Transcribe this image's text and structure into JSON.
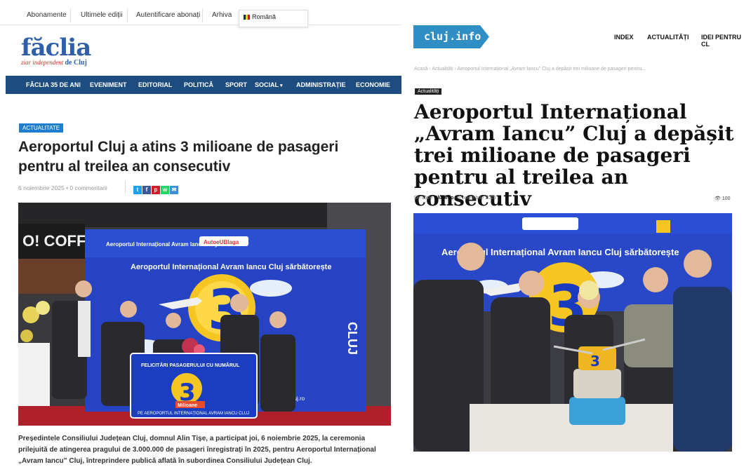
{
  "left": {
    "topbar": {
      "links": [
        "Abonamente",
        "Ultimele ediții",
        "Autentificare abonați",
        "Arhiva"
      ],
      "language": "Română"
    },
    "logo": {
      "name": "făclia",
      "tagline": "ziar independent",
      "tagline_bold": "de Cluj"
    },
    "nav": [
      "FĂCLIA 35 DE ANI",
      "EVENIMENT",
      "EDITORIAL",
      "POLITICĂ",
      "SPORT",
      "SOCIAL",
      "ADMINISTRAȚIE",
      "ECONOMIE"
    ],
    "article": {
      "category": "ACTUALITATE",
      "title": "Aeroportul Cluj a atins 3 milioane de pasageri pentru al treilea an consecutiv",
      "date": "6 noiembrie 2025",
      "comments": "0 commentarii",
      "photo": {
        "coffee_sign": "O! COFFEE",
        "banner_top": "Aeroportul Internațional Avram Iancu Cluj",
        "banner_headline": "Aeroportul Internațional Avram Iancu Cluj sărbătorește",
        "big_number": "3",
        "word": "Milioane",
        "board_title": "FELICITĂRI PASAGERULUI CU NUMĂRUL",
        "board_footer": "PE AEROPORTUL INTERNAȚIONAL AVRAM IANCU CLUJ",
        "url": "www.airportcluj.ro",
        "vertical": "CLUJ",
        "sponsor": "AutoeUBlaga"
      },
      "body": "Președintele Consiliului Județean Cluj, domnul Alin Tișe, a participat joi, 6 noiembrie 2025, la ceremonia prilejuită de atingerea pragului de 3.000.000 de pasageri înregistrați în 2025, pentru Aeroportul Internațional „Avram Iancu” Cluj, întreprindere publică aflată în subordinea Consiliului Județean Cluj."
    }
  },
  "right": {
    "logo": "cluj.info",
    "nav": [
      "INDEX",
      "ACTUALITĂȚI",
      "IDEI PENTRU CL"
    ],
    "breadcrumb": [
      "Acasă",
      "Actualități",
      "Aeroportul Internațional „Avram Iancu” Cluj a depășit trei milioane de pasageri pentru..."
    ],
    "category": "Actualități",
    "title": "Aeroportul Internațional „Avram Iancu” Cluj a depășit trei milioane de pasageri pentru al treilea an consecutiv",
    "author_prefix": "De către",
    "author": "Cluj.info",
    "date": "6 noiembrie 2025",
    "views": "100",
    "photo": {
      "banner_headline": "Aeroportul Internațional Avram Iancu Cluj sărbătorește",
      "big_number": "3"
    }
  },
  "colors": {
    "faclia_blue": "#1d4d80",
    "category_blue": "#1e7fd1",
    "cluj_info_blue": "#2f8fc4",
    "banner_blue": "#1f3fb0"
  }
}
